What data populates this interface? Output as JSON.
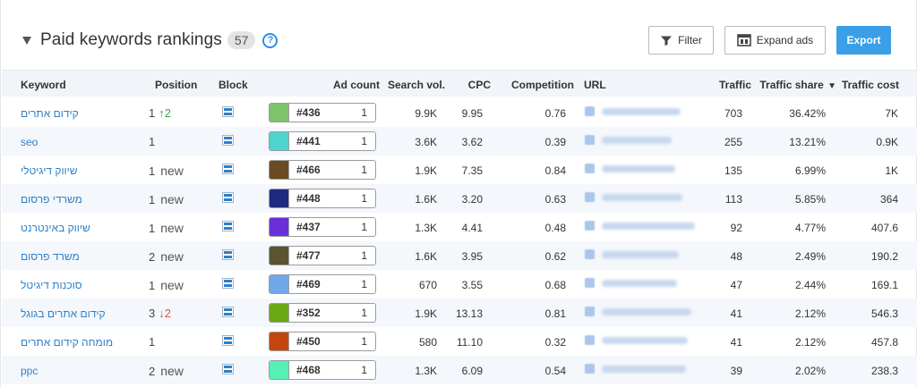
{
  "header": {
    "title": "Paid keywords rankings",
    "count": "57",
    "help_glyph": "?",
    "filter_label": "Filter",
    "expand_label": "Expand ads",
    "export_label": "Export"
  },
  "columns": {
    "keyword": "Keyword",
    "position": "Position",
    "block": "Block",
    "ad_count": "Ad count",
    "search_vol": "Search vol.",
    "cpc": "CPC",
    "competition": "Competition",
    "url": "URL",
    "traffic": "Traffic",
    "traffic_share": "Traffic share",
    "traffic_cost": "Traffic cost"
  },
  "sort_indicator": "▼",
  "rows": [
    {
      "keyword": "קידום אתרים",
      "position": "1",
      "delta": "↑2",
      "delta_dir": "up",
      "ad_code": "#436",
      "ad_color": "#7cc36a",
      "ad_count": "1",
      "search_vol": "9.9K",
      "cpc": "9.95",
      "competition": "0.76",
      "traffic": "703",
      "traffic_share": "36.42%",
      "traffic_cost": "7K"
    },
    {
      "keyword": "seo",
      "position": "1",
      "delta": "",
      "delta_dir": "",
      "ad_code": "#441",
      "ad_color": "#4fd3cf",
      "ad_count": "1",
      "search_vol": "3.6K",
      "cpc": "3.62",
      "competition": "0.39",
      "traffic": "255",
      "traffic_share": "13.21%",
      "traffic_cost": "0.9K"
    },
    {
      "keyword": "שיווק דיגיטלי",
      "position": "1",
      "delta": "new",
      "delta_dir": "new",
      "ad_code": "#466",
      "ad_color": "#6b4a22",
      "ad_count": "1",
      "search_vol": "1.9K",
      "cpc": "7.35",
      "competition": "0.84",
      "traffic": "135",
      "traffic_share": "6.99%",
      "traffic_cost": "1K"
    },
    {
      "keyword": "משרדי פרסום",
      "position": "1",
      "delta": "new",
      "delta_dir": "new",
      "ad_code": "#448",
      "ad_color": "#1e2a80",
      "ad_count": "1",
      "search_vol": "1.6K",
      "cpc": "3.20",
      "competition": "0.63",
      "traffic": "113",
      "traffic_share": "5.85%",
      "traffic_cost": "364"
    },
    {
      "keyword": "שיווק באינטרנט",
      "position": "1",
      "delta": "new",
      "delta_dir": "new",
      "ad_code": "#437",
      "ad_color": "#6a2fd8",
      "ad_count": "1",
      "search_vol": "1.3K",
      "cpc": "4.41",
      "competition": "0.48",
      "traffic": "92",
      "traffic_share": "4.77%",
      "traffic_cost": "407.6"
    },
    {
      "keyword": "משרד פרסום",
      "position": "2",
      "delta": "new",
      "delta_dir": "new",
      "ad_code": "#477",
      "ad_color": "#5a5430",
      "ad_count": "1",
      "search_vol": "1.6K",
      "cpc": "3.95",
      "competition": "0.62",
      "traffic": "48",
      "traffic_share": "2.49%",
      "traffic_cost": "190.2"
    },
    {
      "keyword": "סוכנות דיגיטל",
      "position": "1",
      "delta": "new",
      "delta_dir": "new",
      "ad_code": "#469",
      "ad_color": "#6fa8e8",
      "ad_count": "1",
      "search_vol": "670",
      "cpc": "3.55",
      "competition": "0.68",
      "traffic": "47",
      "traffic_share": "2.44%",
      "traffic_cost": "169.1"
    },
    {
      "keyword": "קידום אתרים בגוגל",
      "position": "3",
      "delta": "↓2",
      "delta_dir": "down",
      "ad_code": "#352",
      "ad_color": "#6aa814",
      "ad_count": "1",
      "search_vol": "1.9K",
      "cpc": "13.13",
      "competition": "0.81",
      "traffic": "41",
      "traffic_share": "2.12%",
      "traffic_cost": "546.3"
    },
    {
      "keyword": "מומחה קידום אתרים",
      "position": "1",
      "delta": "",
      "delta_dir": "",
      "ad_code": "#450",
      "ad_color": "#c4460e",
      "ad_count": "1",
      "search_vol": "580",
      "cpc": "11.10",
      "competition": "0.32",
      "traffic": "41",
      "traffic_share": "2.12%",
      "traffic_cost": "457.8"
    },
    {
      "keyword": "ppc",
      "position": "2",
      "delta": "new",
      "delta_dir": "new",
      "ad_code": "#468",
      "ad_color": "#55f0b4",
      "ad_count": "1",
      "search_vol": "1.3K",
      "cpc": "6.09",
      "competition": "0.54",
      "traffic": "39",
      "traffic_share": "2.02%",
      "traffic_cost": "238.3"
    }
  ]
}
